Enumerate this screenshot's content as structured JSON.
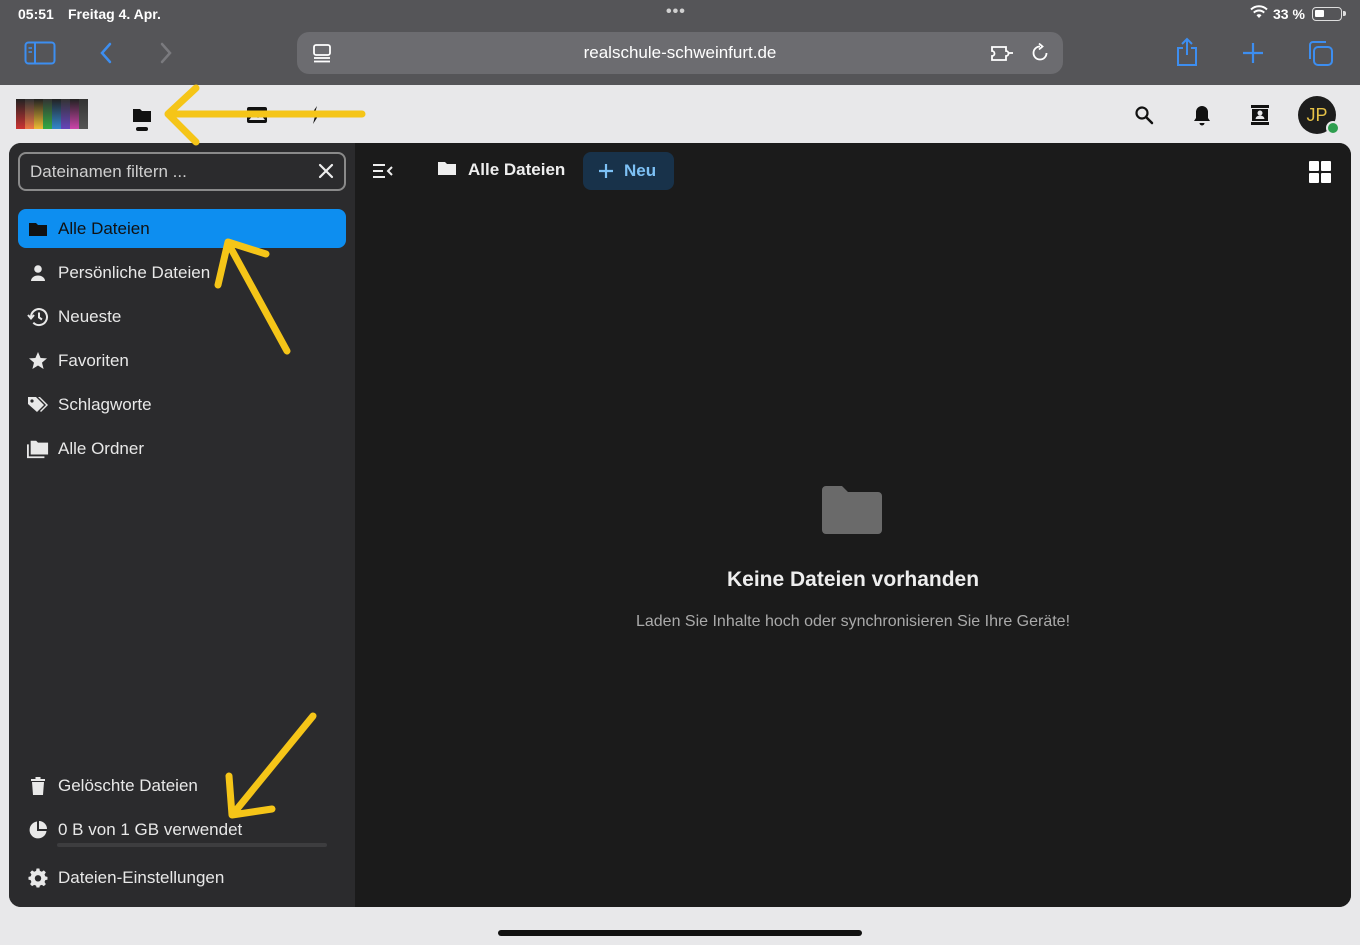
{
  "status_bar": {
    "time": "05:51",
    "date": "Freitag 4. Apr.",
    "dots": "•••",
    "battery": "33 %",
    "battery_level": 0.33
  },
  "browser": {
    "url": "realschule-schweinfurt.de",
    "accent_color": "#3d8ef0"
  },
  "nextcloud_header": {
    "apps": [
      {
        "icon": "files-icon",
        "active": true
      },
      {
        "icon": "activity-icon"
      },
      {
        "icon": "photos-icon"
      },
      {
        "icon": "lightning-icon"
      }
    ],
    "right_icons": [
      "search-icon",
      "bell-icon",
      "contacts-icon"
    ],
    "avatar_initials": "JP",
    "avatar_status_color": "#2e9e4f"
  },
  "sidebar": {
    "filter_placeholder": "Dateinamen filtern ...",
    "items": [
      {
        "label": "Alle Dateien",
        "icon": "folder-icon",
        "active": true
      },
      {
        "label": "Persönliche Dateien",
        "icon": "person-icon"
      },
      {
        "label": "Neueste",
        "icon": "history-icon"
      },
      {
        "label": "Favoriten",
        "icon": "star-icon"
      },
      {
        "label": "Schlagworte",
        "icon": "tags-icon"
      },
      {
        "label": "Alle Ordner",
        "icon": "folders-icon"
      }
    ],
    "footer": {
      "deleted": "Gelöschte Dateien",
      "quota": "0 B von 1 GB verwendet",
      "quota_used_fraction": 0,
      "settings": "Dateien-Einstellungen"
    }
  },
  "content": {
    "breadcrumb": "Alle Dateien",
    "new_button": "Neu",
    "empty_title": "Keine Dateien vorhanden",
    "empty_subtitle": "Laden Sie Inhalte hoch oder synchronisieren Sie Ihre Geräte!"
  },
  "colors": {
    "active_nav": "#0d8ef0",
    "annotation_arrows": "#f5c518"
  }
}
